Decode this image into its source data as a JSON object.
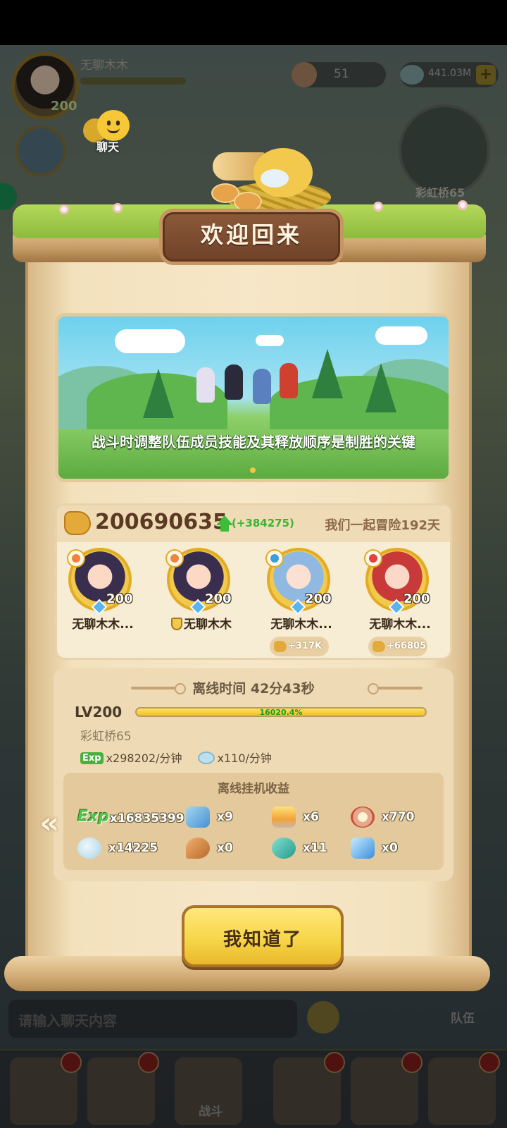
{
  "hud": {
    "player_name": "无聊木木",
    "player_level": "200",
    "resource_1_value": "51",
    "resource_2_value": "441.03M",
    "chat_label": "聊天",
    "minimap_label": "彩虹桥65"
  },
  "dialog": {
    "title": "欢迎回来",
    "banner_tip": "战斗时调整队伍成员技能及其释放顺序是制胜的关键",
    "power": {
      "value": "200690635",
      "gain": "(+384275)",
      "days_together": "我们一起冒险192天"
    },
    "heroes": [
      {
        "name": "无聊木木...",
        "level": "200",
        "element": "fire",
        "gain": ""
      },
      {
        "name": "无聊木木",
        "level": "200",
        "element": "fire",
        "gain": "",
        "has_badge": true
      },
      {
        "name": "无聊木木...",
        "level": "200",
        "element": "water",
        "gain": "+317K"
      },
      {
        "name": "无聊木木...",
        "level": "200",
        "element": "fire",
        "gain": "+66805"
      }
    ],
    "offline": {
      "time": "离线时间 42分43秒",
      "level_label": "LV200",
      "level_progress_text": "16020.4%",
      "stage": "彩虹桥65",
      "exp_tag": "Exp",
      "exp_rate": "x298202/分钟",
      "pearl_rate": "x110/分钟",
      "rewards_title": "离线挂机收益",
      "rewards": [
        {
          "icon": "exp-icon",
          "label": "Exp",
          "value": "x16835399"
        },
        {
          "icon": "crystal-shard-icon",
          "value": "x9"
        },
        {
          "icon": "campfire-icon",
          "value": "x6"
        },
        {
          "icon": "medal-icon",
          "value": "x770"
        },
        {
          "icon": "pearl-icon",
          "value": "x14225"
        },
        {
          "icon": "drumstick-icon",
          "value": "x0"
        },
        {
          "icon": "fish-icon",
          "value": "x11"
        },
        {
          "icon": "ice-crystal-icon",
          "value": "x0"
        }
      ]
    },
    "back_chevron": "«",
    "confirm_label": "我知道了"
  },
  "bottom": {
    "chat_placeholder": "请输入聊天内容",
    "team_label": "队伍",
    "battle_label": "战斗"
  },
  "colors": {
    "gain_green": "#38b535",
    "title_brown": "#6f4128",
    "button_yellow": "#f7d64a",
    "parchment": "#f6e7c8"
  }
}
